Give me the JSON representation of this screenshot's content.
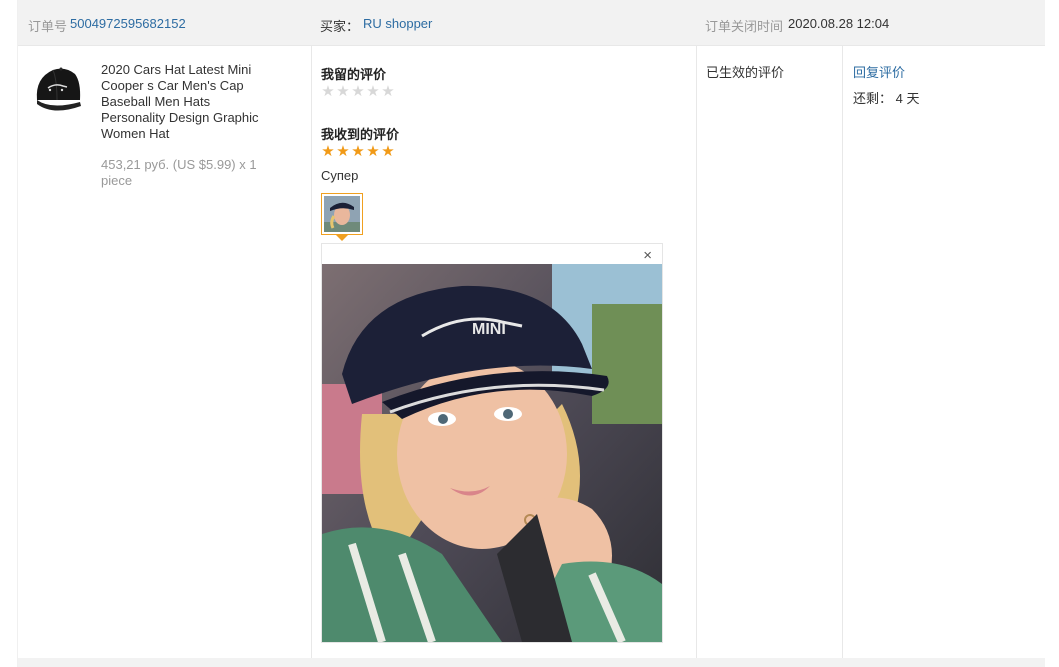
{
  "header": {
    "order_label": "订单号",
    "order_number": "5004972595682152",
    "buyer_label": "买家：",
    "buyer_name": "RU shopper",
    "closed_label": "订单关闭时间",
    "closed_time": "2020.08.28 12:04"
  },
  "product": {
    "title": "2020 Cars Hat Latest Mini Cooper s Car Men's Cap Baseball Men Hats Personality Design Graphic Women Hat",
    "price": "453,21 руб. (US $5.99) x 1 piece",
    "thumb_icon": "black-baseball-cap-image"
  },
  "review": {
    "my_review_label": "我留的评价",
    "my_review_stars": 0,
    "received_label": "我收到的评价",
    "received_stars": 5,
    "received_text": "Супер",
    "close_icon": "×",
    "photo_icon": "customer-photo-woman-in-cap"
  },
  "status": {
    "effective_label": "已生效的评价",
    "reply_label": "回复评价",
    "remaining_label": "还剩：",
    "remaining_value": "4 天"
  },
  "colors": {
    "link": "#2d6ca2",
    "star_full": "#f19a17",
    "star_empty": "#d8d8d8",
    "header_bg": "#f2f2f2"
  }
}
